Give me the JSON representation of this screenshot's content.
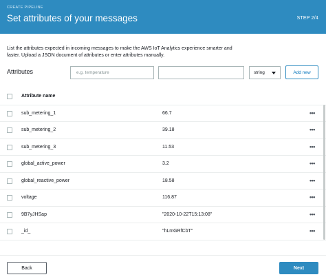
{
  "header": {
    "eyebrow": "CREATE PIPELINE",
    "title": "Set attributes of your messages",
    "step": "STEP 2/4",
    "color": "#2e8bc0"
  },
  "description": "List the attributes expected in incoming messages to make the AWS IoT Analytics experience smarter and faster. Upload a JSON document of attributes or enter attributes manually.",
  "form": {
    "label": "Attributes",
    "name_placeholder": "e.g. temperature",
    "value_placeholder": "",
    "type_selected": "string",
    "add_label": "Add new"
  },
  "table": {
    "header": "Attribute name",
    "rows": [
      {
        "name": "sub_metering_1",
        "value": "66.7"
      },
      {
        "name": "sub_metering_2",
        "value": "39.18"
      },
      {
        "name": "sub_metering_3",
        "value": "11.53"
      },
      {
        "name": "global_active_power",
        "value": "3.2"
      },
      {
        "name": "global_reactive_power",
        "value": "18.58"
      },
      {
        "name": "voltage",
        "value": "116.87"
      },
      {
        "name": "9B7yJHSap",
        "value": "\"2020-10-22T15:13:08\""
      },
      {
        "name": "_id_",
        "value": "\"hLmGRfCbT\""
      }
    ],
    "more_icon": "•••"
  },
  "footer": {
    "back_label": "Back",
    "next_label": "Next"
  }
}
